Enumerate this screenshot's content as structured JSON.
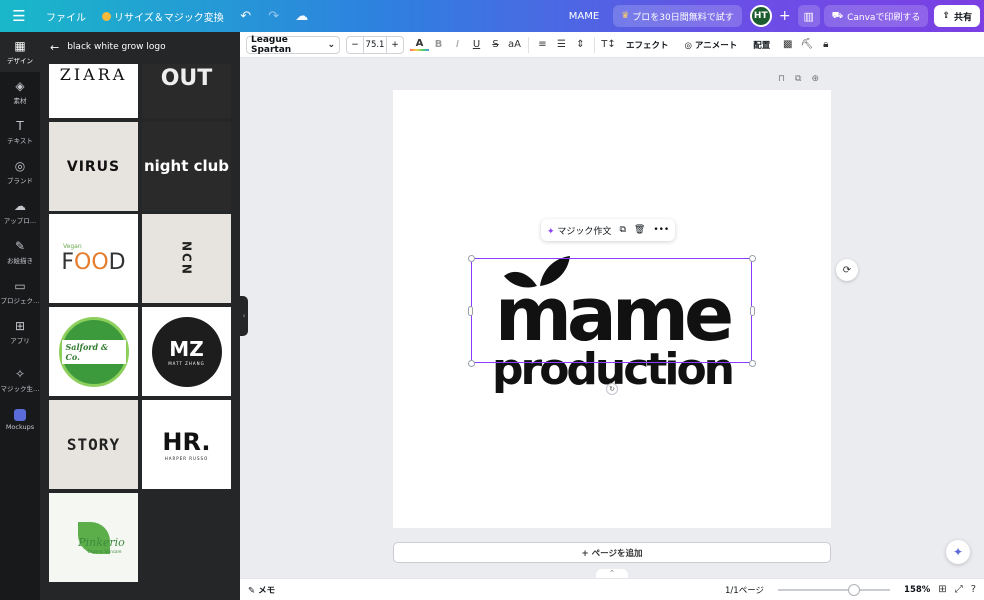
{
  "topbar": {
    "menu_icon": "hamburger-icon",
    "file_label": "ファイル",
    "resize_label": "リサイズ＆マジック変換",
    "design_title": "MAME",
    "pro_label": "プロを30日間無料で試す",
    "avatar_initials": "HT",
    "print_label": "Canvaで印刷する",
    "share_label": "共有"
  },
  "rail": {
    "items": [
      {
        "label": "デザイン"
      },
      {
        "label": "素材"
      },
      {
        "label": "テキスト"
      },
      {
        "label": "ブランド"
      },
      {
        "label": "アップロ…"
      },
      {
        "label": "お絵描き"
      },
      {
        "label": "プロジェク…"
      },
      {
        "label": "アプリ"
      },
      {
        "label": "マジック生…"
      },
      {
        "label": "Mockups"
      }
    ]
  },
  "panel": {
    "search_title": "black white grow logo",
    "thumbs": {
      "zara": "ZIARA",
      "out": "OUT",
      "virus": "VIRUS",
      "night": "night club",
      "food_top": "Vegan",
      "food_a": "F",
      "food_b": "OO",
      "food_c": "D",
      "ncn": "NCN",
      "salford": "Salford & Co.",
      "mz": "MZ",
      "mz_sub": "MATT ZHANG",
      "story": "STORY",
      "hr": "HR.",
      "hr_sub": "HARPER RUSSO",
      "pink": "Pinkerio",
      "pink_sub": "Organic Skincare"
    }
  },
  "toolbar": {
    "font_name": "League Spartan",
    "font_size": "75.1",
    "minus": "−",
    "plus": "+",
    "effect_label": "エフェクト",
    "animate_label": "アニメート",
    "position_label": "配置"
  },
  "canvas": {
    "context_magic_label": "マジック作文",
    "logo_line1": "mame",
    "logo_line2": "production",
    "add_page_label": "+ ページを追加"
  },
  "statusbar": {
    "memo_label": "メモ",
    "page_counter": "1/1ページ",
    "zoom": "158%"
  },
  "colors": {
    "accent_purple": "#8b3dff",
    "topbar_start": "#19b8c9",
    "topbar_end": "#7b3fe4",
    "rail_bg": "#18191b",
    "panel_bg": "#252627"
  }
}
